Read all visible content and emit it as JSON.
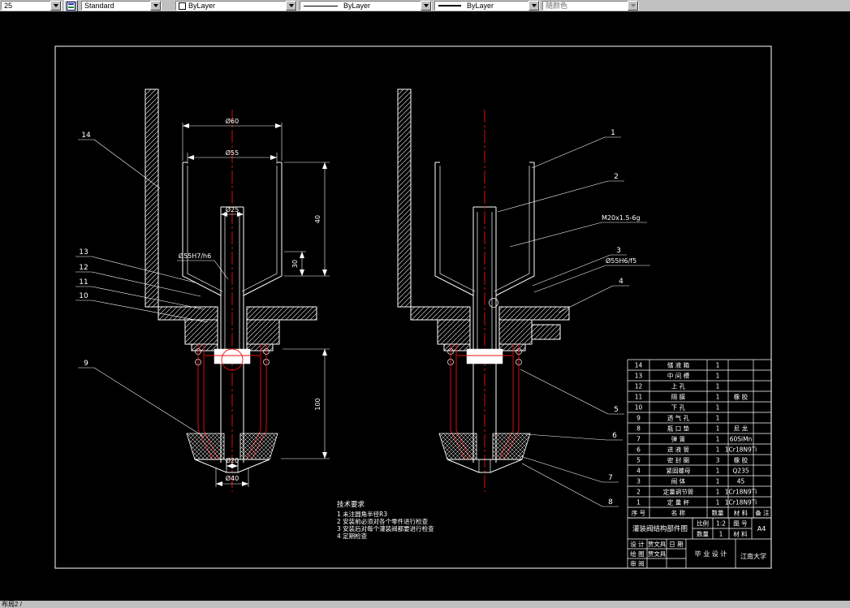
{
  "palette": {
    "canvas_bg": "#000000",
    "line": "#ffffff",
    "centerline": "#ee1010",
    "chrome": "#c0c0c0"
  },
  "toolbar": {
    "layer_combo": "25",
    "style_combo": "Standard",
    "color_combo": "ByLayer",
    "linetype_combo": "ByLayer",
    "lineweight_combo": "ByLayer",
    "plotstyle_combo": "随颜色"
  },
  "statusbar": {
    "tab_label": "布局2 /"
  },
  "drawing": {
    "dims": {
      "d60": "Ø60",
      "d55": "Ø55",
      "d25": "Ø25",
      "fit_left": "Ø55H7/h6",
      "h40": "40",
      "h30": "30",
      "h100": "100",
      "d20": "Ø20",
      "d40": "Ø40",
      "thread": "M20x1.5-6g",
      "fit_right": "Ø55H6/f5"
    },
    "callouts": {
      "left": [
        "14",
        "13",
        "12",
        "11",
        "10",
        "9"
      ],
      "right": [
        "1",
        "2",
        "3",
        "4",
        "5",
        "6",
        "7",
        "8"
      ]
    },
    "tech": {
      "title": "技术要求",
      "items": [
        "1 未注圆角半径R3",
        "2 安装前必须对各个零件进行检查",
        "3 安装后对每个灌装阀都要进行检查",
        "4 定期检查"
      ]
    },
    "bom": {
      "headers": [
        "序 号",
        "名  称",
        "数量",
        "材 料",
        "备 注"
      ],
      "rows": [
        [
          "14",
          "储 液 箱",
          "1",
          "",
          ""
        ],
        [
          "13",
          "中 间 槽",
          "1",
          "",
          ""
        ],
        [
          "12",
          "上  孔",
          "1",
          "",
          ""
        ],
        [
          "11",
          "隔  膜",
          "1",
          "橡 胶",
          ""
        ],
        [
          "10",
          "下  孔",
          "1",
          "",
          ""
        ],
        [
          "9",
          "透 气 孔",
          "1",
          "",
          ""
        ],
        [
          "8",
          "瓶 口 垫",
          "1",
          "尼 龙",
          ""
        ],
        [
          "7",
          "弹  簧",
          "1",
          "60SiMn",
          ""
        ],
        [
          "6",
          "进 液 管",
          "1",
          "1Cr18N9Ti",
          ""
        ],
        [
          "5",
          "密 封 圈",
          "3",
          "橡 胶",
          ""
        ],
        [
          "4",
          "紧固螺母",
          "1",
          "Q235",
          ""
        ],
        [
          "3",
          "阀  体",
          "1",
          "45",
          ""
        ],
        [
          "2",
          "定量调节管",
          "1",
          "1Cr18N9Ti",
          ""
        ],
        [
          "1",
          "定 量 杯",
          "1",
          "1Cr18N9Ti",
          ""
        ]
      ]
    },
    "titleblock": {
      "title": "灌装阀结构部件图",
      "scale_label": "比例",
      "scale_value": "1:2",
      "qty_label": "数量",
      "qty_value": "1",
      "figno_label": "图 号",
      "material_label": "材 料",
      "sheet": "A4",
      "design_label": "设 计",
      "draw_label": "绘 图",
      "review_label": "审 阅",
      "designer": "贾文具",
      "drafter": "贾文具",
      "date_label": "日 期",
      "project": "毕 业 设 计",
      "school": "江南大学"
    }
  }
}
